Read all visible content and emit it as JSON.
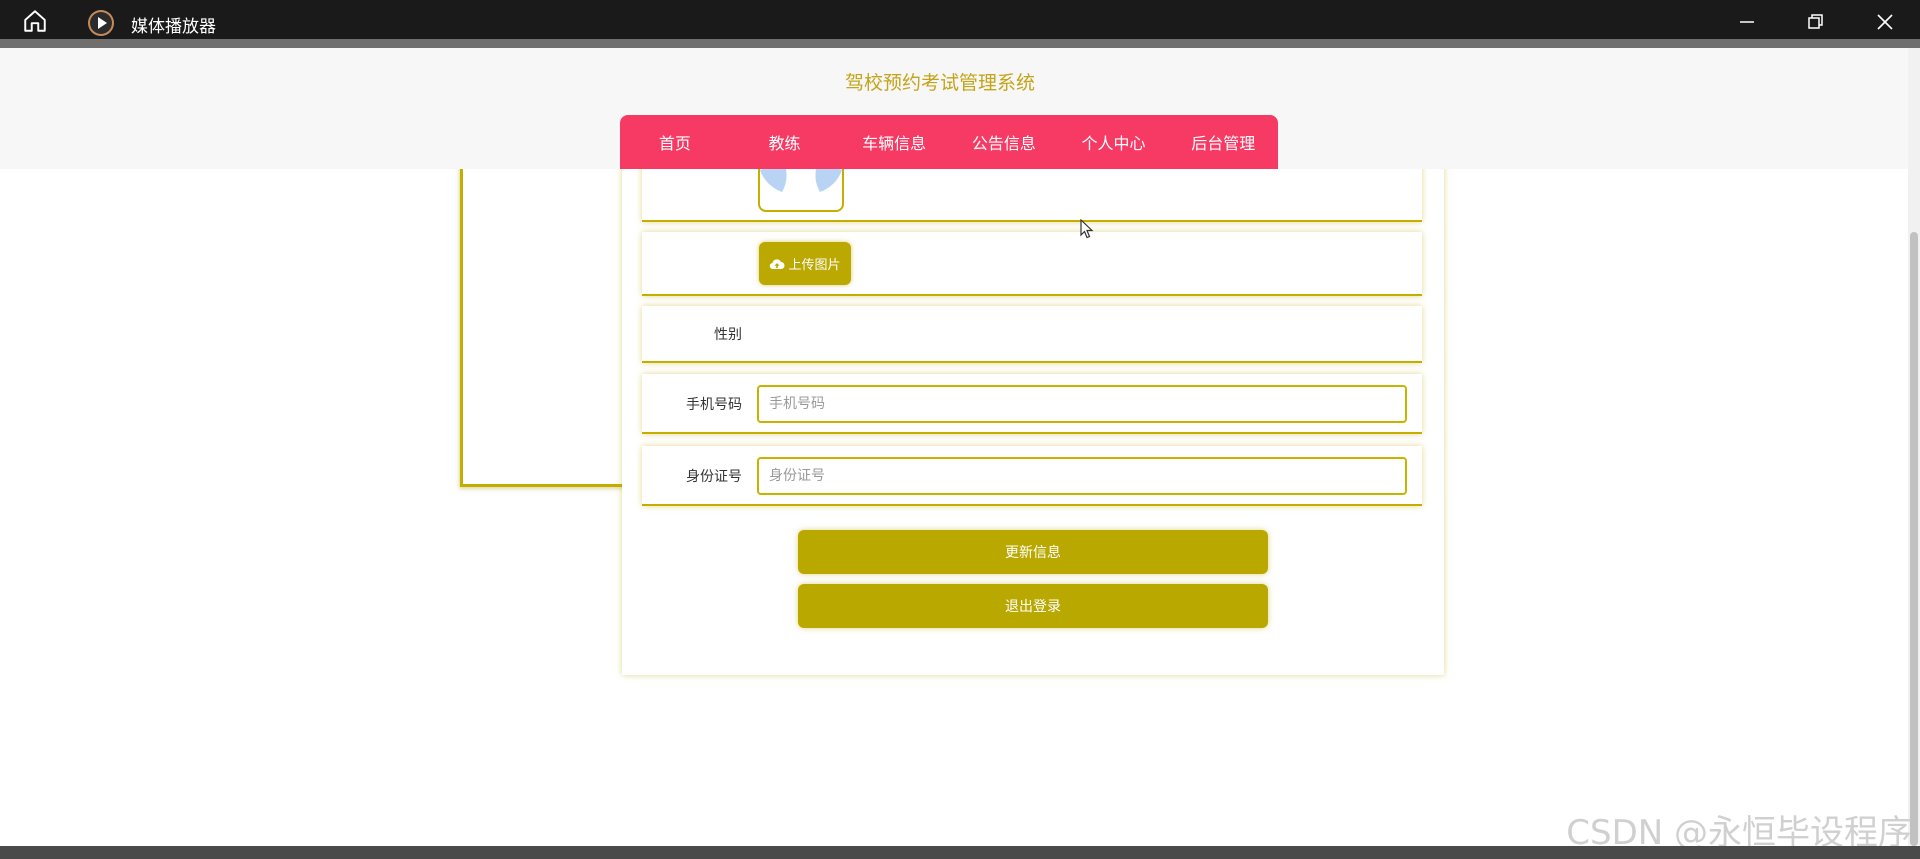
{
  "window": {
    "title": "媒体播放器",
    "controls": [
      "minimize",
      "maximize",
      "close"
    ]
  },
  "site": {
    "title": "驾校预约考试管理系统",
    "nav": [
      "首页",
      "教练",
      "车辆信息",
      "公告信息",
      "个人中心",
      "后台管理"
    ]
  },
  "form": {
    "upload_label": "上传图片",
    "gender_label": "性别",
    "phone_label": "手机号码",
    "phone_placeholder": "手机号码",
    "id_label": "身份证号",
    "id_placeholder": "身份证号",
    "update_button": "更新信息",
    "logout_button": "退出登录"
  },
  "watermark": "CSDN @永恒毕设程序",
  "colors": {
    "nav_bg": "#f63a64",
    "accent": "#bba800",
    "title": "#c4a418"
  }
}
